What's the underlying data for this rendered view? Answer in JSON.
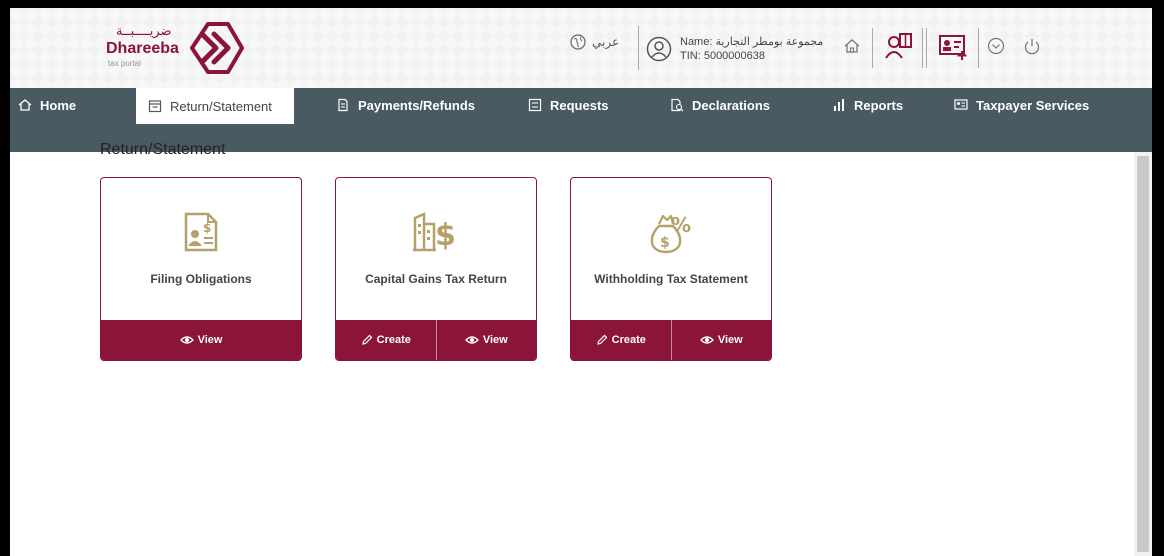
{
  "header": {
    "logo": {
      "arabic": "ضريــــبــة",
      "english": "Dhareeba",
      "sub": "tax portal"
    },
    "language_label": "عربي",
    "user": {
      "name_line": "Name: مجموعة بومطر التجارية",
      "tin_line": "TIN: 5000000638"
    },
    "icons": [
      "globe-icon",
      "user-circle-icon",
      "home-icon",
      "users-book-icon",
      "id-card-plus-icon",
      "chevron-down-icon",
      "power-icon"
    ]
  },
  "nav": {
    "items": [
      {
        "label": "Home",
        "icon": "home-icon"
      },
      {
        "label": "Return/Statement",
        "icon": "calendar-icon"
      },
      {
        "label": "Payments/Refunds",
        "icon": "document-money-icon"
      },
      {
        "label": "Requests",
        "icon": "checklist-icon"
      },
      {
        "label": "Declarations",
        "icon": "document-search-icon"
      },
      {
        "label": "Reports",
        "icon": "bar-chart-icon"
      },
      {
        "label": "Taxpayer Services",
        "icon": "id-card-icon"
      }
    ],
    "active": "Return/Statement"
  },
  "page": {
    "title": "Return/Statement"
  },
  "cards": [
    {
      "title": "Filing Obligations",
      "icon": "filing-obligations-icon",
      "actions": [
        {
          "label": "View",
          "icon": "eye-icon"
        }
      ]
    },
    {
      "title": "Capital Gains Tax Return",
      "icon": "building-dollar-icon",
      "actions": [
        {
          "label": "Create",
          "icon": "pencil-icon"
        },
        {
          "label": "View",
          "icon": "eye-icon"
        }
      ]
    },
    {
      "title": "Withholding Tax Statement",
      "icon": "money-bag-percent-icon",
      "actions": [
        {
          "label": "Create",
          "icon": "pencil-icon"
        },
        {
          "label": "View",
          "icon": "eye-icon"
        }
      ]
    }
  ],
  "colors": {
    "brand": "#8a1538",
    "nav_bg": "#4a5a63",
    "icon_gold": "#b5a06a"
  }
}
